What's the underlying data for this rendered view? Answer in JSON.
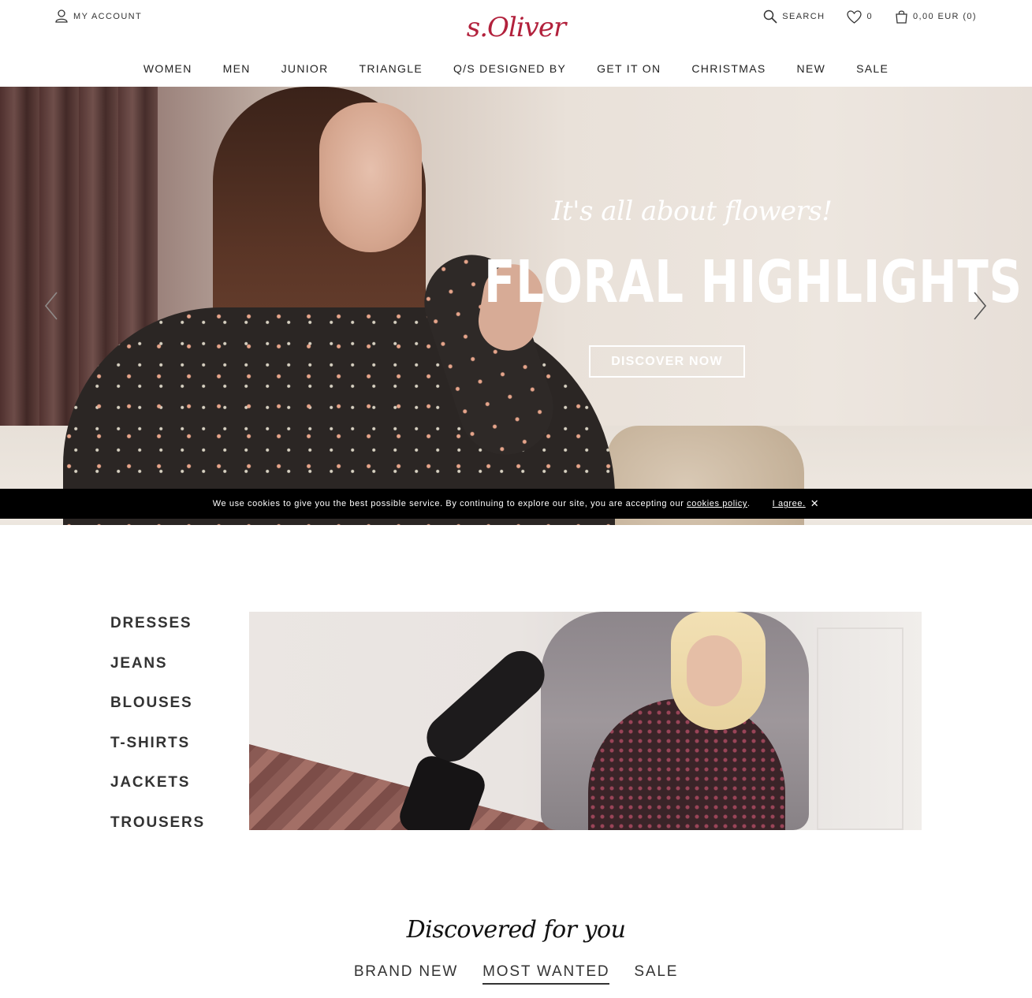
{
  "header": {
    "account_label": "MY ACCOUNT",
    "logo_text": "s.Oliver",
    "search_label": "SEARCH",
    "wishlist_count": "0",
    "cart_label": "0,00 EUR (0)"
  },
  "nav": {
    "items": [
      "WOMEN",
      "MEN",
      "JUNIOR",
      "TRIANGLE",
      "Q/S DESIGNED BY",
      "GET IT ON",
      "CHRISTMAS",
      "NEW",
      "SALE"
    ]
  },
  "hero": {
    "script_text": "It's all about flowers!",
    "title": "FLORAL HIGHLIGHTS",
    "cta_label": "DISCOVER NOW"
  },
  "cookie_bar": {
    "text": "We use cookies to give you the best possible service. By continuing to explore our site, you are accepting our ",
    "link_text": "cookies policy",
    "suffix": ".",
    "agree_label": "I agree.",
    "close_glyph": "✕"
  },
  "categories": {
    "items": [
      "DRESSES",
      "JEANS",
      "BLOUSES",
      "T-SHIRTS",
      "JACKETS",
      "TROUSERS"
    ]
  },
  "discovered": {
    "title": "Discovered for you",
    "tabs": [
      "BRAND NEW",
      "MOST WANTED",
      "SALE"
    ],
    "active_tab": "MOST WANTED"
  },
  "colors": {
    "brand": "#b2213c",
    "cookie_bar_bg": "#000000",
    "text": "#333333"
  },
  "icons": {
    "account": "user-icon",
    "search": "search-icon",
    "wishlist": "heart-icon",
    "cart": "shopping-bag-icon",
    "prev": "chevron-left-icon",
    "next": "chevron-right-icon"
  }
}
